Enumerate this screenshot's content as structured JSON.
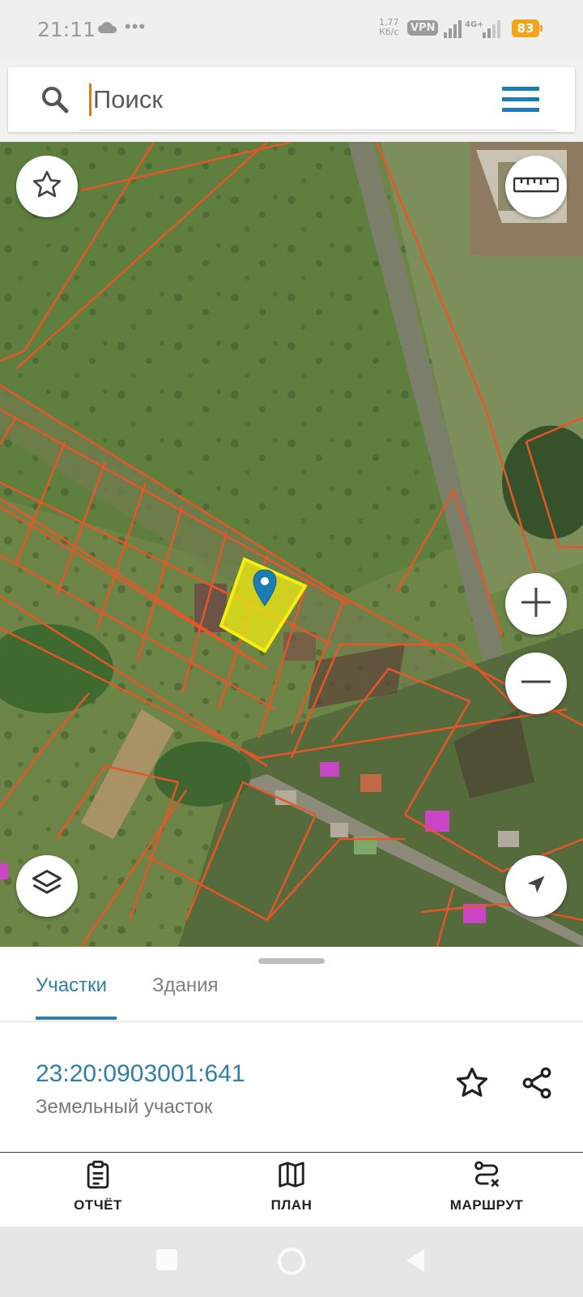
{
  "status_bar": {
    "time": "21:11",
    "speed_value": "1,77",
    "speed_unit": "Кб/с",
    "vpn": "VPN",
    "network": "4G+",
    "battery": "83"
  },
  "search": {
    "placeholder": "Поиск"
  },
  "map": {
    "icons": {
      "favorites": "star-outline",
      "ruler": "ruler",
      "zoom_in": "plus",
      "zoom_out": "minus",
      "layers": "layers",
      "location": "navigation-arrow",
      "marker": "map-pin"
    },
    "colors": {
      "parcel_border": "#e8552a",
      "selected_parcel": "#f2ea12",
      "marker": "#1b7db4"
    }
  },
  "sheet": {
    "tabs": [
      {
        "label": "Участки",
        "active": true
      },
      {
        "label": "Здания",
        "active": false
      }
    ],
    "parcel": {
      "cadastral_number": "23:20:0903001:641",
      "type": "Земельный участок"
    },
    "actions": [
      {
        "label": "ОТЧЁТ",
        "icon": "clipboard-report"
      },
      {
        "label": "ПЛАН",
        "icon": "map-plan"
      },
      {
        "label": "МАРШРУТ",
        "icon": "route"
      }
    ]
  },
  "colors": {
    "accent": "#2f7fae",
    "menu": "#1b7db4",
    "battery": "#f2a51a"
  }
}
